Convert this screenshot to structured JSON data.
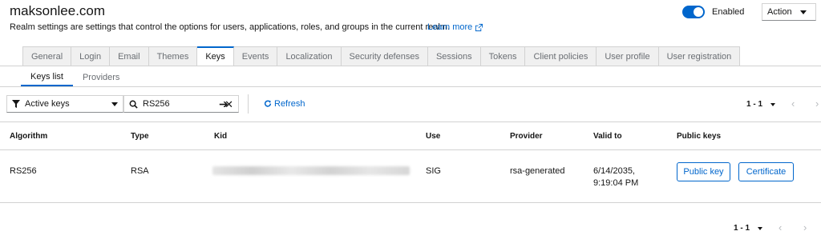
{
  "header": {
    "realm_name": "maksonlee.com",
    "description": "Realm settings are settings that control the options for users, applications, roles, and groups in the current realm.",
    "learn_more": "Learn more",
    "enabled_label": "Enabled",
    "action_label": "Action"
  },
  "tabs": [
    "General",
    "Login",
    "Email",
    "Themes",
    "Keys",
    "Events",
    "Localization",
    "Security defenses",
    "Sessions",
    "Tokens",
    "Client policies",
    "User profile",
    "User registration"
  ],
  "active_tab": "Keys",
  "subtabs": [
    "Keys list",
    "Providers"
  ],
  "toolbar": {
    "filter_label": "Active keys",
    "search_value": "RS256",
    "refresh_label": "Refresh"
  },
  "pagination": {
    "range": "1 - 1"
  },
  "table": {
    "columns": [
      "Algorithm",
      "Type",
      "Kid",
      "Use",
      "Provider",
      "Valid to",
      "Public keys"
    ],
    "rows": [
      {
        "algorithm": "RS256",
        "type": "RSA",
        "use": "SIG",
        "provider": "rsa-generated",
        "valid_to_date": "6/14/2035,",
        "valid_to_time": "9:19:04 PM",
        "public_key_button": "Public key",
        "certificate_button": "Certificate"
      }
    ]
  },
  "colors": {
    "accent": "#0066cc",
    "border": "#d2d2d2",
    "muted": "#6a6e73"
  }
}
